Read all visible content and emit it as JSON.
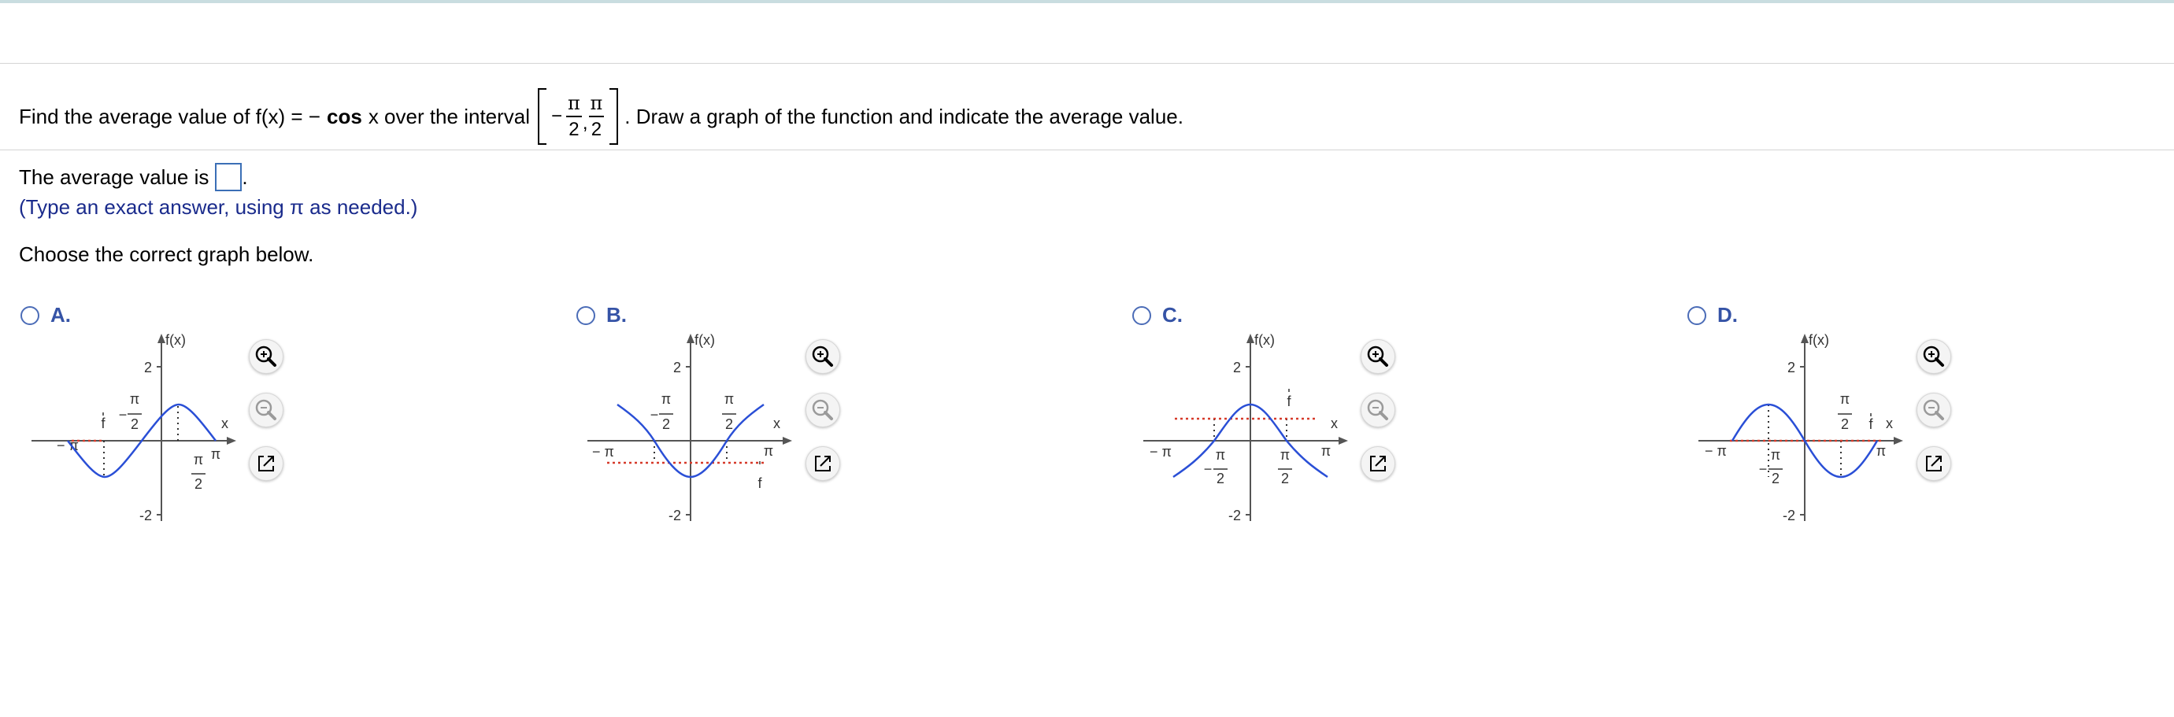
{
  "question": {
    "prefix": "Find the average value of f(x) = −",
    "func_bold": "cos",
    "func_rest": "x over the interval",
    "interval": {
      "minus": "−",
      "num1": "π",
      "den1": "2",
      "comma": ",",
      "num2": "π",
      "den2": "2"
    },
    "suffix": ". Draw a graph of the function and indicate the average value."
  },
  "answer": {
    "label": "The average value is",
    "value": "",
    "period": "."
  },
  "hint": "(Type an exact answer, using π as needed.)",
  "choose_text": "Choose the correct graph below.",
  "options": [
    {
      "letter": "A."
    },
    {
      "letter": "B."
    },
    {
      "letter": "C."
    },
    {
      "letter": "D."
    }
  ],
  "graph_labels": {
    "fx": "f(x)",
    "x": "x",
    "two": "2",
    "neg_two": "-2",
    "pi": "π",
    "neg_pi": "− π",
    "minus": "−",
    "f": "f"
  },
  "colors": {
    "curve": "#2a4fd6",
    "average_line": "#d63a2a",
    "accent": "#3553a6"
  },
  "icons": [
    "zoom-in-icon",
    "zoom-out-icon",
    "popout-icon"
  ]
}
